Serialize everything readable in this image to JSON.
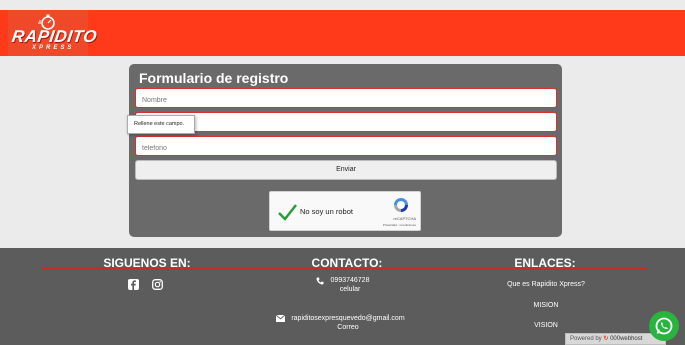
{
  "header": {
    "brand": "RAPIDITO",
    "brand_sub": "XPRESS"
  },
  "form": {
    "title": "Formulario de registro",
    "fields": [
      {
        "placeholder": "Nombre"
      },
      {
        "placeholder": ""
      },
      {
        "placeholder": "telefono"
      }
    ],
    "submit_label": "Enviar",
    "validation_tooltip": "Rellene este campo."
  },
  "captcha": {
    "label": "No soy un robot",
    "brand": "reCAPTCHA",
    "terms": "Privacidad - Condiciones"
  },
  "footer": {
    "social_title": "SIGUENOS EN:",
    "contact_title": "CONTACTO:",
    "links_title": "ENLACES:",
    "phone": "0993746728",
    "phone_label": "celular",
    "email": "rapiditosexpresquevedo@gmail.com",
    "email_label": "Correo",
    "links": [
      "Que es Rapidito Xpress?",
      "MISION",
      "VISION"
    ]
  },
  "powered_by": "Powered by",
  "powered_brand": "000webhost",
  "colors": {
    "header": "#ff3a1a",
    "card": "#6a6a6a",
    "footer": "#5c5c5c",
    "accent_red": "#d0281f",
    "whatsapp": "#29b33f"
  }
}
